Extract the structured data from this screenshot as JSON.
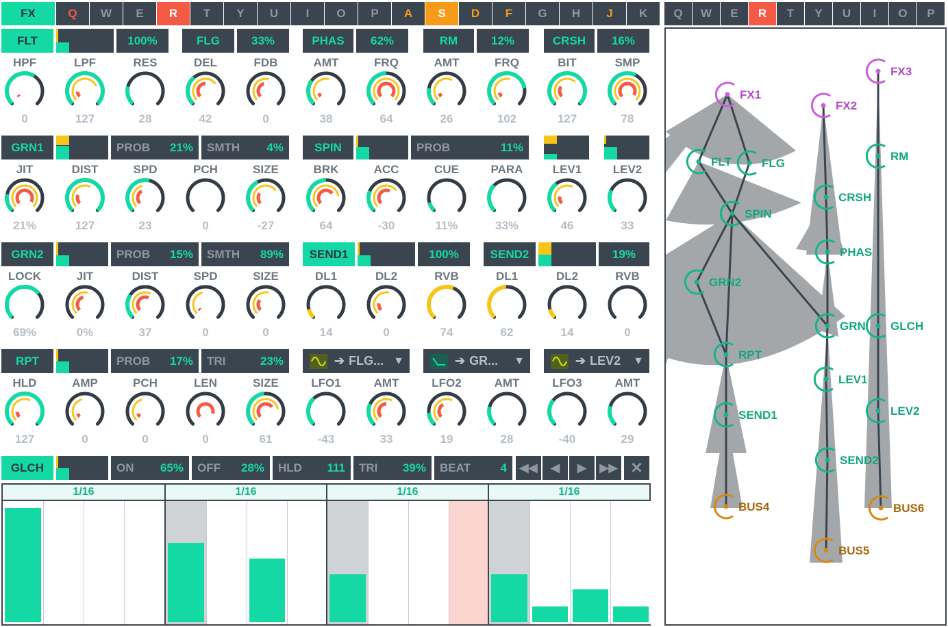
{
  "fx_tab": "FX",
  "left_keys": [
    {
      "k": "Q",
      "s": "redt"
    },
    {
      "k": "W",
      "s": ""
    },
    {
      "k": "E",
      "s": ""
    },
    {
      "k": "R",
      "s": "red"
    },
    {
      "k": "T",
      "s": ""
    },
    {
      "k": "Y",
      "s": ""
    },
    {
      "k": "U",
      "s": ""
    },
    {
      "k": "I",
      "s": ""
    },
    {
      "k": "O",
      "s": ""
    },
    {
      "k": "P",
      "s": ""
    },
    {
      "k": "A",
      "s": "ort"
    },
    {
      "k": "S",
      "s": "or"
    },
    {
      "k": "D",
      "s": "ort"
    },
    {
      "k": "F",
      "s": "ort"
    },
    {
      "k": "G",
      "s": ""
    },
    {
      "k": "H",
      "s": ""
    },
    {
      "k": "J",
      "s": "ort"
    },
    {
      "k": "K",
      "s": ""
    }
  ],
  "right_keys": [
    {
      "k": "Q",
      "s": ""
    },
    {
      "k": "W",
      "s": ""
    },
    {
      "k": "E",
      "s": ""
    },
    {
      "k": "R",
      "s": "red"
    },
    {
      "k": "T",
      "s": ""
    },
    {
      "k": "Y",
      "s": ""
    },
    {
      "k": "U",
      "s": ""
    },
    {
      "k": "I",
      "s": ""
    },
    {
      "k": "O",
      "s": ""
    },
    {
      "k": "P",
      "s": ""
    }
  ],
  "modules": {
    "flt": {
      "name": "FLT",
      "level": 0.45
    },
    "flg": {
      "name": "FLG",
      "mix": "100%",
      "amt": "33%"
    },
    "phas": {
      "name": "PHAS",
      "amt": "62%"
    },
    "rm": {
      "name": "RM",
      "amt": "12%"
    },
    "crsh": {
      "name": "CRSH",
      "amt": "16%"
    },
    "grn1": {
      "name": "GRN1",
      "level": 0.55,
      "prob_label": "PROB",
      "prob": "21%",
      "smth_label": "SMTH",
      "smth": "4%"
    },
    "spin": {
      "name": "SPIN",
      "prob_label": "PROB",
      "prob": "11%",
      "level": 0.5
    },
    "grn2": {
      "name": "GRN2",
      "prob_label": "PROB",
      "prob": "15%",
      "smth_label": "SMTH",
      "smth": "89%"
    },
    "send1": {
      "name": "SEND1",
      "amt": "100%"
    },
    "send2": {
      "name": "SEND2",
      "amt": "19%"
    },
    "rpt": {
      "name": "RPT",
      "prob_label": "PROB",
      "prob": "17%",
      "tri_label": "TRI",
      "tri": "23%"
    },
    "glch": {
      "name": "GLCH",
      "on_label": "ON",
      "on": "65%",
      "off_label": "OFF",
      "off": "28%",
      "hld_label": "HLD",
      "hld": "111",
      "tri_label": "TRI",
      "tri": "39%",
      "beat_label": "BEAT",
      "beat": "4"
    }
  },
  "lfo_routes": [
    {
      "target": "FLG...",
      "wave": "sine"
    },
    {
      "target": "GR...",
      "wave": "ramp"
    },
    {
      "target": "LEV2",
      "wave": "sine"
    }
  ],
  "knob_rows": [
    [
      {
        "label": "HPF",
        "value": "0",
        "outer": 0.62,
        "mid": 0,
        "inner": 0.05,
        "color": "#14d9a4"
      },
      {
        "label": "LPF",
        "value": "127",
        "outer": 1,
        "mid": 0.75,
        "inner": 0.15,
        "color": "#14d9a4"
      },
      {
        "label": "RES",
        "value": "28",
        "outer": 0.22,
        "mid": 0,
        "inner": 0,
        "color": "#14d9a4"
      },
      {
        "label": "DEL",
        "value": "42",
        "outer": 0.35,
        "mid": 0.7,
        "inner": 0.5,
        "color": "#14d9a4"
      },
      {
        "label": "FDB",
        "value": "0",
        "outer": 0,
        "mid": 0.55,
        "inner": 0.45,
        "color": "#14d9a4"
      },
      {
        "label": "AMT",
        "value": "38",
        "outer": 0.3,
        "mid": 0.55,
        "inner": 0.1,
        "color": "#14d9a4"
      },
      {
        "label": "FRQ",
        "value": "64",
        "outer": 0.5,
        "mid": 1,
        "inner": 1,
        "color": "#14d9a4"
      },
      {
        "label": "AMT",
        "value": "26",
        "outer": 0.2,
        "mid": 0.6,
        "inner": 0.1,
        "color": "#14d9a4"
      },
      {
        "label": "FRQ",
        "value": "102",
        "outer": 0.8,
        "mid": 0.55,
        "inner": 0.12,
        "color": "#14d9a4"
      },
      {
        "label": "BIT",
        "value": "127",
        "outer": 1,
        "mid": 0.65,
        "inner": 0.3,
        "color": "#14d9a4"
      },
      {
        "label": "SMP",
        "value": "78",
        "outer": 0.6,
        "mid": 1,
        "inner": 0.95,
        "color": "#14d9a4"
      }
    ],
    [
      {
        "label": "JIT",
        "value": "21%",
        "outer": 0.21,
        "mid": 1,
        "inner": 0.95,
        "color": "#14d9a4"
      },
      {
        "label": "DIST",
        "value": "127",
        "outer": 1,
        "mid": 0.6,
        "inner": 0.25,
        "color": "#14d9a4"
      },
      {
        "label": "SPD",
        "value": "23",
        "outer": 0.55,
        "mid": 0.45,
        "inner": 0.4,
        "color": "#14d9a4"
      },
      {
        "label": "PCH",
        "value": "0",
        "outer": 0,
        "mid": 0,
        "inner": 0,
        "color": "#14d9a4"
      },
      {
        "label": "SIZE",
        "value": "-27",
        "outer": 0.4,
        "mid": 0.7,
        "inner": 0.3,
        "color": "#14d9a4"
      },
      {
        "label": "BRK",
        "value": "64",
        "outer": 0.5,
        "mid": 0.8,
        "inner": 0.7,
        "color": "#14d9a4"
      },
      {
        "label": "ACC",
        "value": "-30",
        "outer": 0.25,
        "mid": 0.7,
        "inner": 0.6,
        "color": "#14d9a4"
      },
      {
        "label": "CUE",
        "value": "11%",
        "outer": 0.11,
        "mid": 0,
        "inner": 0,
        "color": "#14d9a4"
      },
      {
        "label": "PARA",
        "value": "33%",
        "outer": 0.33,
        "mid": 0,
        "inner": 0,
        "color": "#14d9a4"
      },
      {
        "label": "LEV1",
        "value": "46",
        "outer": 0.36,
        "mid": 0.6,
        "inner": 0.2,
        "color": "#14d9a4"
      },
      {
        "label": "LEV2",
        "value": "33",
        "outer": 0.26,
        "mid": 0,
        "inner": 0,
        "color": "#14d9a4"
      }
    ],
    [
      {
        "label": "LOCK",
        "value": "69%",
        "outer": 0.69,
        "mid": 0,
        "inner": 0,
        "color": "#14d9a4"
      },
      {
        "label": "JIT",
        "value": "0%",
        "outer": 0,
        "mid": 0.55,
        "inner": 0.45,
        "color": "#14d9a4"
      },
      {
        "label": "DIST",
        "value": "37",
        "outer": 0.29,
        "mid": 0.6,
        "inner": 0.6,
        "color": "#14d9a4"
      },
      {
        "label": "SPD",
        "value": "0",
        "outer": 0,
        "mid": 0.45,
        "inner": 0.05,
        "color": "#14d9a4"
      },
      {
        "label": "SIZE",
        "value": "0",
        "outer": 0,
        "mid": 0.55,
        "inner": 0.3,
        "color": "#14d9a4"
      },
      {
        "label": "DL1",
        "value": "14",
        "outer": 0.11,
        "mid": 0,
        "inner": 0,
        "color": "#f7c51a"
      },
      {
        "label": "DL2",
        "value": "0",
        "outer": 0,
        "mid": 0.55,
        "inner": 0.2,
        "color": "#14d9a4"
      },
      {
        "label": "RVB",
        "value": "74",
        "outer": 0.58,
        "mid": 0,
        "inner": 0,
        "color": "#f7c51a"
      },
      {
        "label": "DL1",
        "value": "62",
        "outer": 0.49,
        "mid": 0,
        "inner": 0,
        "color": "#f7c51a"
      },
      {
        "label": "DL2",
        "value": "14",
        "outer": 0.11,
        "mid": 0,
        "inner": 0,
        "color": "#f7c51a"
      },
      {
        "label": "RVB",
        "value": "0",
        "outer": 0,
        "mid": 0,
        "inner": 0,
        "color": "#f7c51a"
      }
    ],
    [
      {
        "label": "HLD",
        "value": "127",
        "outer": 1,
        "mid": 0.6,
        "inner": 0.15,
        "color": "#14d9a4"
      },
      {
        "label": "AMP",
        "value": "0",
        "outer": 0,
        "mid": 0.45,
        "inner": 0.1,
        "color": "#14d9a4"
      },
      {
        "label": "PCH",
        "value": "0",
        "outer": 0,
        "mid": 0.45,
        "inner": 0.1,
        "color": "#14d9a4"
      },
      {
        "label": "LEN",
        "value": "0",
        "outer": 0,
        "mid": 0,
        "inner": 0.9,
        "color": "#14d9a4"
      },
      {
        "label": "SIZE",
        "value": "61",
        "outer": 0.48,
        "mid": 0.8,
        "inner": 0.7,
        "color": "#14d9a4"
      },
      {
        "label": "LFO1",
        "value": "-43",
        "outer": 0.34,
        "mid": 0,
        "inner": 0,
        "color": "#14d9a4"
      },
      {
        "label": "AMT",
        "value": "33",
        "outer": 0.26,
        "mid": 0.6,
        "inner": 0.5,
        "color": "#14d9a4"
      },
      {
        "label": "LFO2",
        "value": "19",
        "outer": 0.15,
        "mid": 0.6,
        "inner": 0.4,
        "color": "#14d9a4"
      },
      {
        "label": "AMT",
        "value": "28",
        "outer": 0.22,
        "mid": 0,
        "inner": 0,
        "color": "#14d9a4"
      },
      {
        "label": "LFO3",
        "value": "-40",
        "outer": 0.31,
        "mid": 0,
        "inner": 0,
        "color": "#14d9a4"
      },
      {
        "label": "AMT",
        "value": "29",
        "outer": 0.23,
        "mid": 0,
        "inner": 0,
        "color": "#14d9a4"
      }
    ]
  ],
  "transport": {
    "rewind_icon": "skip-back-icon",
    "prev_icon": "step-back-icon",
    "next_icon": "step-forward-icon",
    "ff_icon": "skip-forward-icon",
    "close_icon": "close-icon"
  },
  "sequencer": {
    "beats": [
      {
        "label": "1/16",
        "steps": [
          {
            "v": 0.95,
            "bg": "#fff"
          },
          {
            "v": 0,
            "bg": "#fff"
          },
          {
            "v": 0,
            "bg": "#fff"
          },
          {
            "v": 0,
            "bg": "#fff"
          }
        ]
      },
      {
        "label": "1/16",
        "steps": [
          {
            "v": 0.66,
            "bg": "#cfd3d6"
          },
          {
            "v": 0,
            "bg": "#fff"
          },
          {
            "v": 0.53,
            "bg": "#fff"
          },
          {
            "v": 0,
            "bg": "#fff"
          }
        ]
      },
      {
        "label": "1/16",
        "steps": [
          {
            "v": 0.4,
            "bg": "#cfd3d6"
          },
          {
            "v": 0,
            "bg": "#fff"
          },
          {
            "v": 0,
            "bg": "#fff"
          },
          {
            "v": 0,
            "bg": "#fcd5d0"
          }
        ]
      },
      {
        "label": "1/16",
        "steps": [
          {
            "v": 0.4,
            "bg": "#cfd3d6"
          },
          {
            "v": 0.13,
            "bg": "#fff"
          },
          {
            "v": 0.27,
            "bg": "#fff"
          },
          {
            "v": 0.13,
            "bg": "#fff"
          }
        ]
      }
    ]
  },
  "graph": {
    "colors": {
      "fx": "#c95fdb",
      "mod": "#14b58a",
      "bus": "#d98712"
    },
    "nodes": [
      {
        "id": "FX1",
        "kind": "fx"
      },
      {
        "id": "FX2",
        "kind": "fx"
      },
      {
        "id": "FX3",
        "kind": "fx"
      },
      {
        "id": "FLT",
        "kind": "mod"
      },
      {
        "id": "FLG",
        "kind": "mod"
      },
      {
        "id": "SPIN",
        "kind": "mod"
      },
      {
        "id": "GRN2",
        "kind": "mod"
      },
      {
        "id": "RPT",
        "kind": "mod"
      },
      {
        "id": "SEND1",
        "kind": "mod"
      },
      {
        "id": "CRSH",
        "kind": "mod"
      },
      {
        "id": "PHAS",
        "kind": "mod"
      },
      {
        "id": "GRN1",
        "kind": "mod"
      },
      {
        "id": "LEV1",
        "kind": "mod"
      },
      {
        "id": "SEND2",
        "kind": "mod"
      },
      {
        "id": "RM",
        "kind": "mod"
      },
      {
        "id": "GLCH",
        "kind": "mod"
      },
      {
        "id": "LEV2",
        "kind": "mod"
      },
      {
        "id": "BUS4",
        "kind": "bus"
      },
      {
        "id": "BUS5",
        "kind": "bus"
      },
      {
        "id": "BUS6",
        "kind": "bus"
      }
    ],
    "labels": {
      "GRN1": "GRN"
    }
  }
}
